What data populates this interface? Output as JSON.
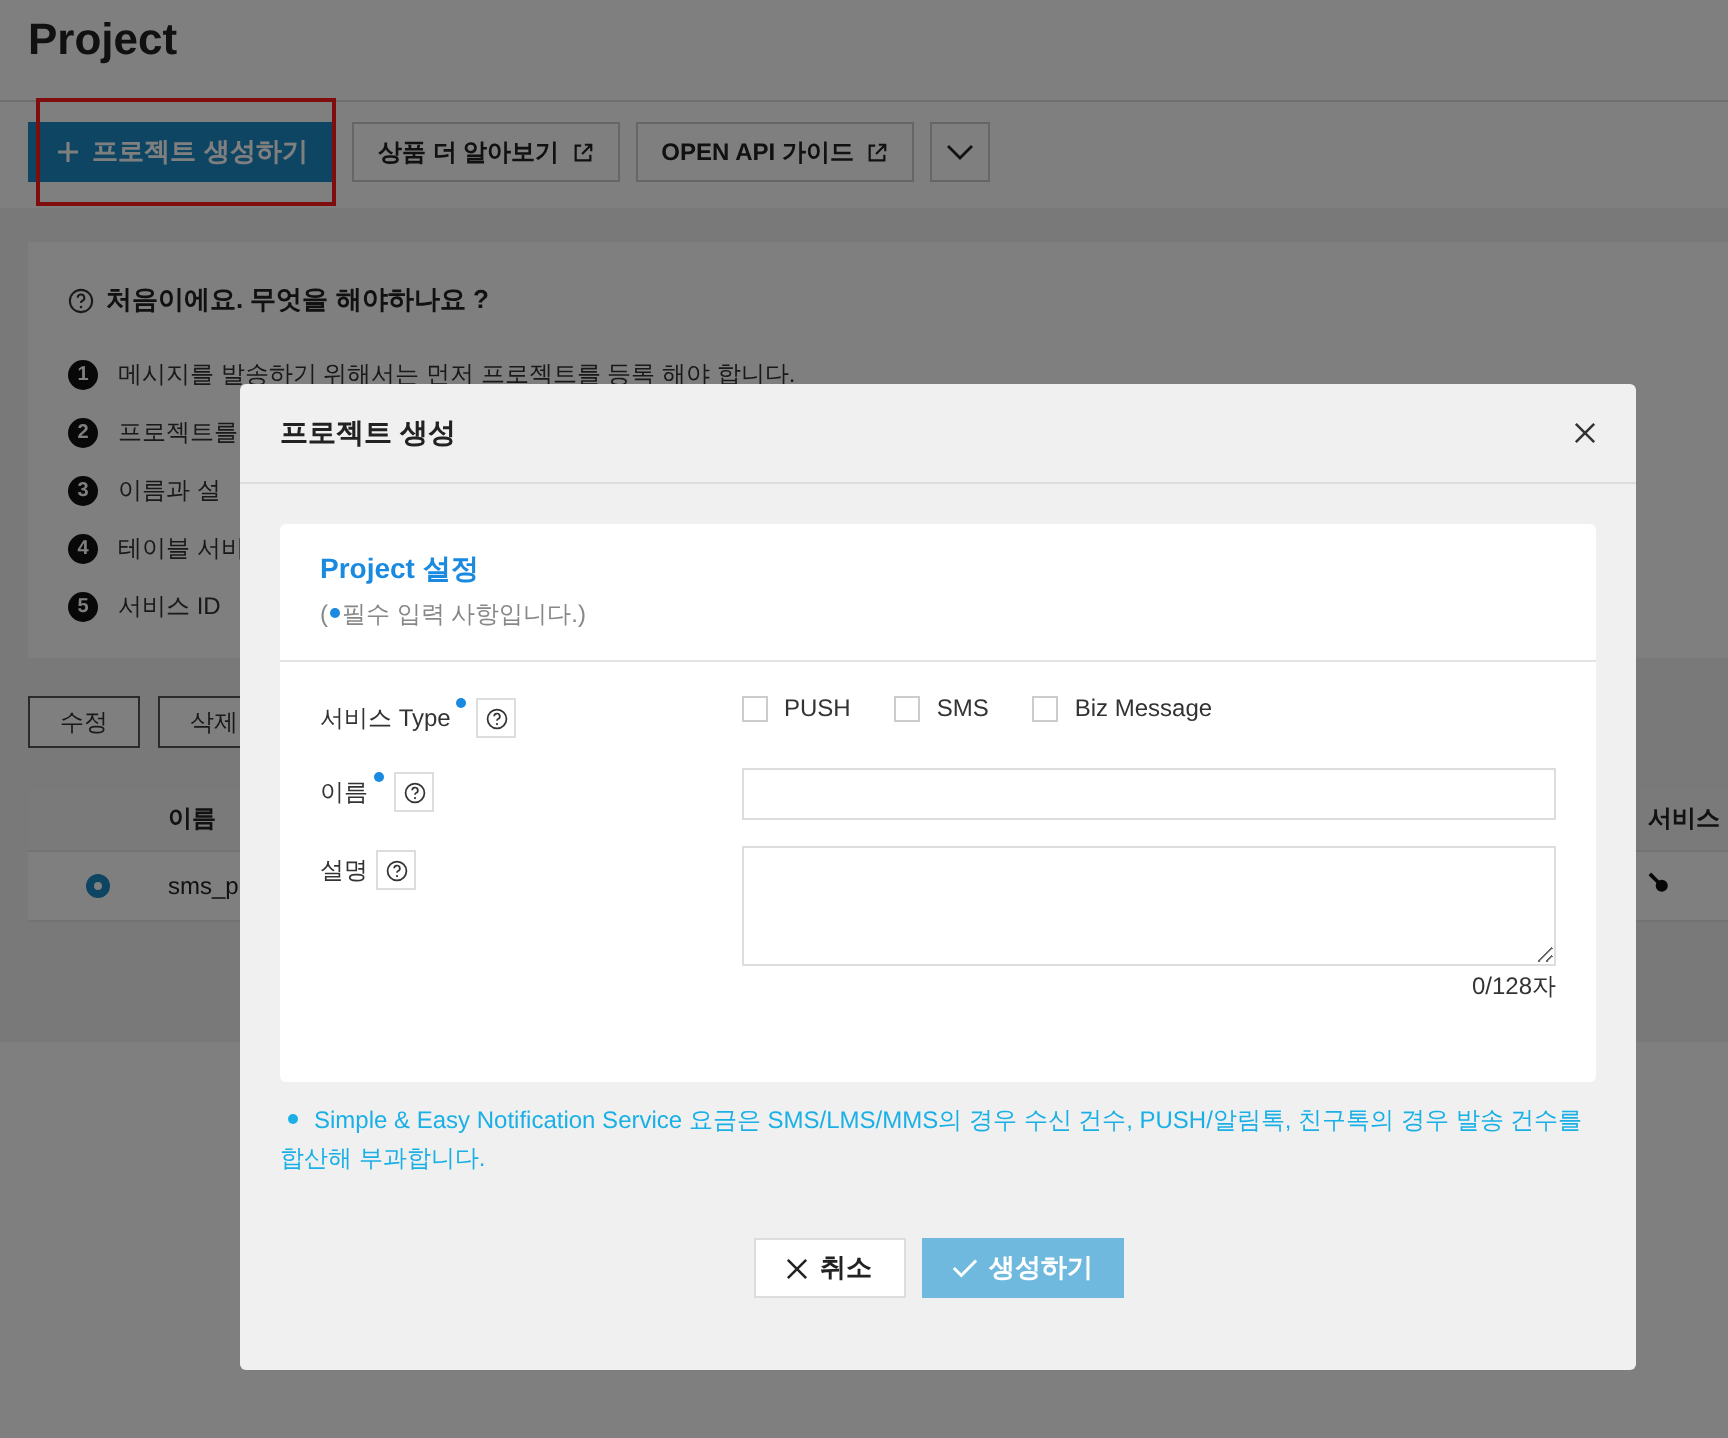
{
  "page": {
    "title": "Project",
    "toolbar": [
      {
        "kind": "primary",
        "label": "프로젝트 생성하기",
        "highlighted": true
      },
      {
        "kind": "external",
        "label": "상품 더 알아보기"
      },
      {
        "kind": "external",
        "label": "OPEN API 가이드"
      },
      {
        "kind": "dropdown"
      }
    ],
    "help": {
      "title": "처음이에요. 무엇을 해야하나요 ?",
      "steps": [
        {
          "number": "1",
          "text": "메시지를 발송하기 위해서는 먼저 프로젝트를 등록 해야 합니다."
        },
        {
          "number": "2",
          "text": "프로젝트를"
        },
        {
          "number": "3",
          "text": "이름과 설"
        },
        {
          "number": "4",
          "text": "테이블 서비"
        },
        {
          "number": "5",
          "text": "서비스 ID"
        }
      ]
    },
    "actions": [
      "수정",
      "삭제"
    ],
    "table": {
      "columns": [
        "이름",
        "서비스"
      ],
      "rows": [
        {
          "selected": true,
          "name": "sms_p"
        }
      ]
    }
  },
  "dialog": {
    "title": "프로젝트 생성",
    "section_title": "Project 설정",
    "legend_before": "(",
    "legend_after": "필수 입력 사항입니다.)",
    "fields": [
      {
        "kind": "checkboxes",
        "label": "서비스 Type",
        "required": true,
        "options": [
          {
            "label": "PUSH",
            "checked": false
          },
          {
            "label": "SMS",
            "checked": false
          },
          {
            "label": "Biz Message",
            "checked": false
          }
        ]
      },
      {
        "kind": "text",
        "label": "이름",
        "required": true
      },
      {
        "kind": "textarea",
        "label": "설명",
        "required": false,
        "counter": "0/128자"
      }
    ],
    "note": "Simple & Easy Notification Service 요금은 SMS/LMS/MMS의 경우 수신 건수, PUSH/알림톡, 친구톡의 경우 발송 건수를 합산해 부과합니다.",
    "buttons": [
      {
        "kind": "cancel",
        "label": "취소",
        "disabled": false
      },
      {
        "kind": "submit",
        "label": "생성하기",
        "disabled": true
      }
    ]
  }
}
